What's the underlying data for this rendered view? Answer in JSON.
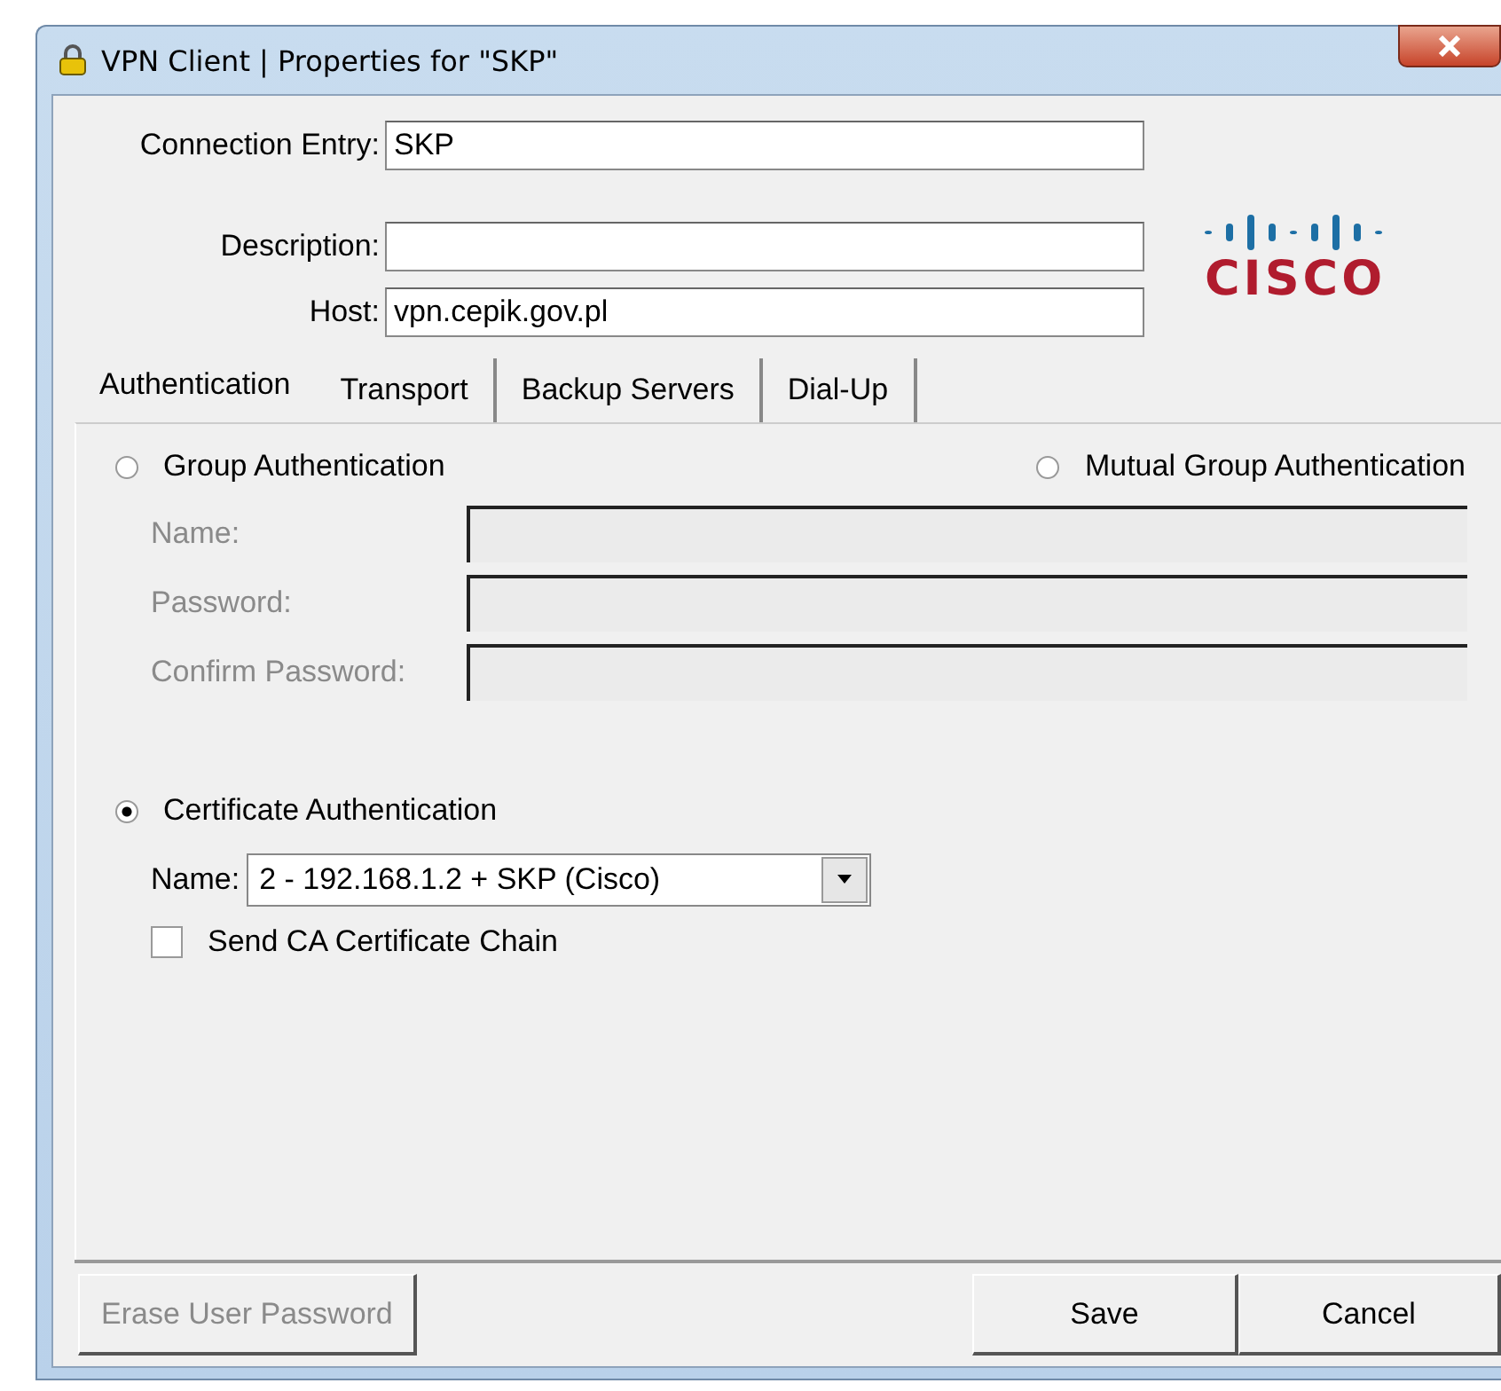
{
  "window": {
    "title": "VPN Client  |  Properties for \"SKP\""
  },
  "logo": {
    "text": "CISCO"
  },
  "fields": [
    {
      "label": "Connection Entry:",
      "value": "SKP"
    },
    {
      "label": "Description:"
    },
    {
      "label": "Host:",
      "value": "vpn.cepik.gov.pl"
    }
  ],
  "tabs": [
    {
      "label": "Authentication",
      "selected": true
    },
    {
      "label": "Transport",
      "selected": false
    },
    {
      "label": "Backup Servers",
      "selected": false
    },
    {
      "label": "Dial-Up",
      "selected": false
    }
  ],
  "auth": {
    "group": {
      "label": "Group Authentication",
      "selected": false
    },
    "mutual": {
      "label": "Mutual Group Authentication",
      "selected": false
    },
    "group_fields": [
      {
        "label": "Name:",
        "disabled": true
      },
      {
        "label": "Password:",
        "disabled": true
      },
      {
        "label": "Confirm Password:",
        "disabled": true
      }
    ],
    "certificate": {
      "label": "Certificate Authentication",
      "selected": true
    },
    "cert_name": {
      "label": "Name:",
      "value": "2 - 192.168.1.2 + SKP (Cisco)"
    },
    "send_chain": {
      "label": "Send CA Certificate Chain",
      "checked": false
    }
  },
  "buttons": [
    {
      "label": "Erase User Password",
      "disabled": true
    },
    {
      "label": "Save",
      "disabled": false
    },
    {
      "label": "Cancel",
      "disabled": false
    }
  ]
}
